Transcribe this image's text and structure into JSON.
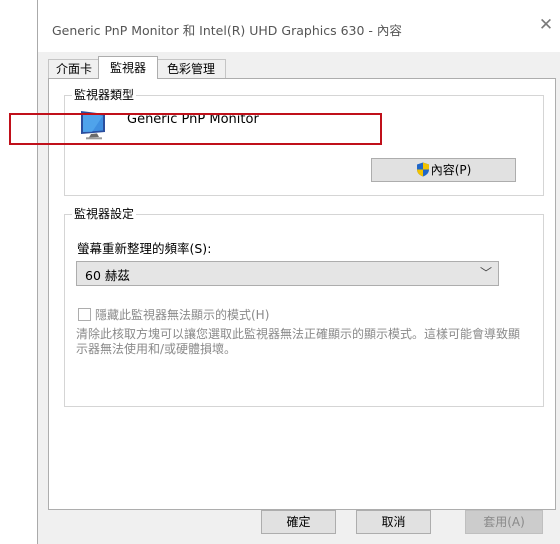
{
  "window": {
    "title": "Generic PnP Monitor 和 Intel(R) UHD Graphics 630 - 內容",
    "close_glyph": "✕"
  },
  "tabs": [
    {
      "label": "介面卡",
      "active": false
    },
    {
      "label": "監視器",
      "active": true
    },
    {
      "label": "色彩管理",
      "active": false
    }
  ],
  "monitor_type": {
    "group_title": "監視器類型",
    "icon": "monitor-icon",
    "name": "Generic PnP Monitor",
    "properties_button": "內容(P)",
    "properties_icon": "uac-shield-icon"
  },
  "monitor_settings": {
    "group_title": "監視器設定",
    "refresh_label": "螢幕重新整理的頻率(S):",
    "refresh_value": "60 赫茲",
    "hide_modes_label": "隱藏此監視器無法顯示的模式(H)",
    "hide_modes_checked": false,
    "hide_modes_enabled": false,
    "description": "清除此核取方塊可以讓您選取此監視器無法正確顯示的顯示模式。這樣可能會導致顯示器無法使用和/或硬體損壞。"
  },
  "footer": {
    "ok": "確定",
    "cancel": "取消",
    "apply": "套用(A)",
    "apply_enabled": false
  },
  "colors": {
    "highlight": "#c0101a",
    "shield_blue": "#1f66c8",
    "shield_yellow": "#f2c200"
  }
}
